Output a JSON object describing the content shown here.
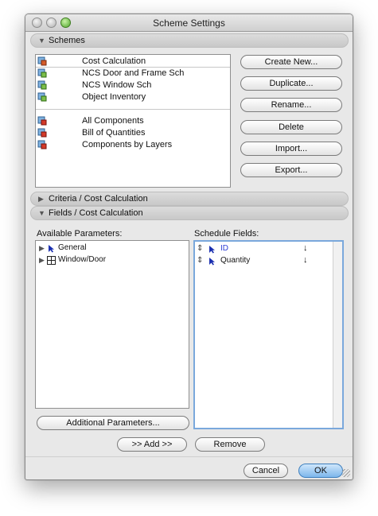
{
  "window": {
    "title": "Scheme Settings"
  },
  "sections": {
    "schemes": "Schemes",
    "criteria": "Criteria /  Cost Calculation",
    "fields": "Fields /  Cost Calculation"
  },
  "schemes": {
    "group1": [
      "Cost Calculation",
      "NCS Door and Frame Sch",
      "NCS Window Sch",
      "Object Inventory"
    ],
    "group2": [
      "All Components",
      "Bill of Quantities",
      "Components by Layers"
    ],
    "selected": "Cost Calculation",
    "buttons": {
      "create": "Create New...",
      "duplicate": "Duplicate...",
      "rename": "Rename...",
      "delete": "Delete",
      "import": "Import...",
      "export": "Export..."
    }
  },
  "fields": {
    "available_label": "Available Parameters:",
    "schedule_label": "Schedule Fields:",
    "available": [
      "General",
      "Window/Door"
    ],
    "schedule": [
      "ID",
      "Quantity"
    ],
    "additional_button": "Additional Parameters...",
    "add_button": ">> Add >>",
    "remove_button": "Remove"
  },
  "footer": {
    "cancel": "Cancel",
    "ok": "OK"
  },
  "colors": {
    "accent": "#3f7fbd",
    "id_field": "#2a3bd4"
  }
}
